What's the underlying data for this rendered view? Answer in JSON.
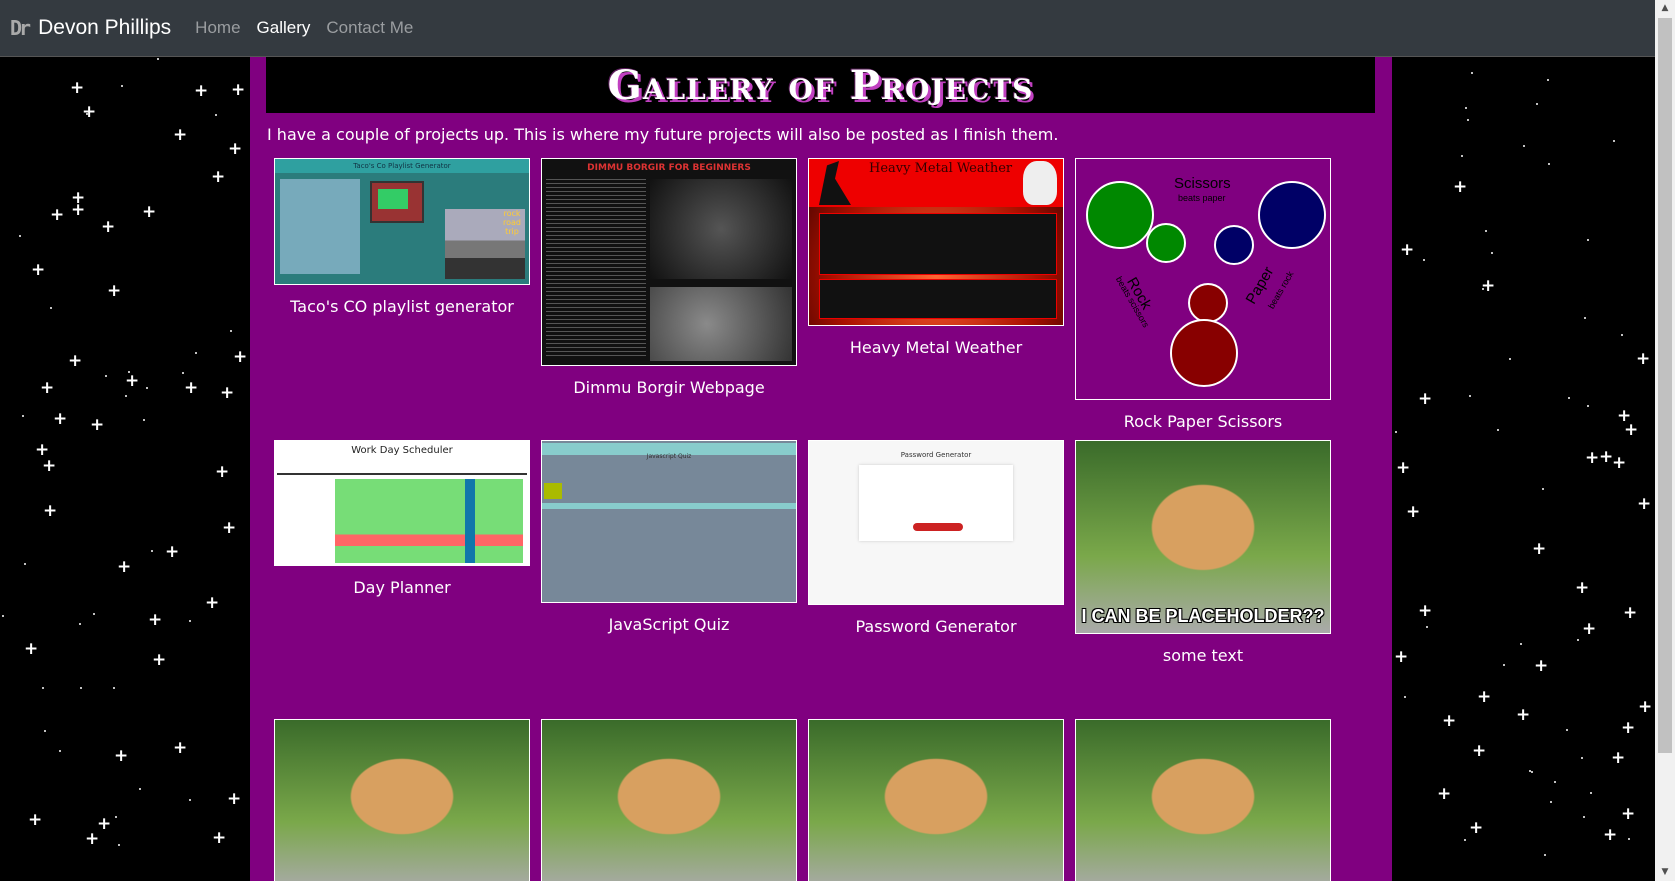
{
  "nav": {
    "logo": "Dr",
    "brand": "Devon Phillips",
    "links": [
      "Home",
      "Gallery",
      "Contact Me"
    ],
    "active": "Gallery"
  },
  "page": {
    "title": "Gallery of Projects",
    "intro": "I have a couple of projects up. This is where my future projects will also be posted as I finish them."
  },
  "projects": [
    {
      "caption": "Taco's CO playlist generator",
      "thumb_title": "Taco's Co Playlist Generator",
      "thumb_text": "rock road trip"
    },
    {
      "caption": "Dimmu Borgir Webpage",
      "thumb_title": "DIMMU BORGIR FOR BEGINNERS"
    },
    {
      "caption": "Heavy Metal Weather",
      "thumb_title": "Heavy Metal Weather"
    },
    {
      "caption": "Rock Paper Scissors",
      "thumb_labels": [
        "Scissors",
        "beats paper",
        "Rock",
        "beats scissors",
        "Paper",
        "beats rock"
      ]
    },
    {
      "caption": "Day Planner",
      "thumb_title": "Work Day Scheduler"
    },
    {
      "caption": "JavaScript Quiz",
      "thumb_title": "Javascript Quiz"
    },
    {
      "caption": "Password Generator",
      "thumb_title": "Password Generator"
    },
    {
      "caption": "some text",
      "thumb_text": "I CAN BE PLACEHOLDER??"
    }
  ],
  "colors": {
    "main_bg": "#800080",
    "navbar_bg": "#343a40",
    "space_bg": "#000000"
  },
  "icons": {
    "logo": "dr-logo-icon",
    "scroll_up": "chevron-up-icon",
    "scroll_down": "chevron-down-icon"
  }
}
